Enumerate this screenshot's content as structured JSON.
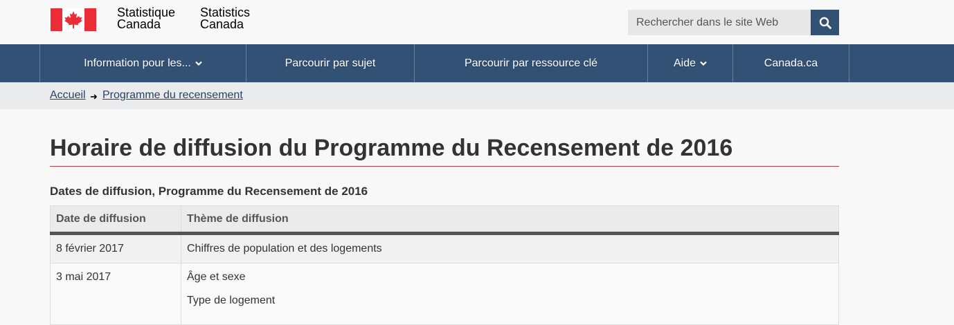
{
  "header": {
    "signature_fr_line1": "Statistique",
    "signature_fr_line2": "Canada",
    "signature_en_line1": "Statistics",
    "signature_en_line2": "Canada",
    "search_placeholder": "Rechercher dans le site Web",
    "search_icon": "search-icon"
  },
  "menu": {
    "items": [
      {
        "label": "Information pour les...",
        "has_dropdown": true
      },
      {
        "label": "Parcourir par sujet",
        "has_dropdown": false
      },
      {
        "label": "Parcourir par ressource clé",
        "has_dropdown": false
      },
      {
        "label": "Aide",
        "has_dropdown": true
      },
      {
        "label": "Canada.ca",
        "has_dropdown": false
      }
    ]
  },
  "breadcrumb": {
    "items": [
      "Accueil",
      "Programme du recensement"
    ]
  },
  "page": {
    "title": "Horaire de diffusion du Programme du Recensement de 2016",
    "table_caption": "Dates de diffusion, Programme du Recensement de 2016"
  },
  "table": {
    "headers": [
      "Date de diffusion",
      "Thème de diffusion"
    ],
    "rows": [
      {
        "date": "8 février 2017",
        "themes": [
          "Chiffres de population et des logements"
        ]
      },
      {
        "date": "3 mai 2017",
        "themes": [
          "Âge et sexe",
          "Type de logement"
        ]
      }
    ]
  },
  "colors": {
    "nav_blue": "#335075",
    "title_rule": "#af3c43",
    "link": "#284162",
    "flag_red": "#eb2d37"
  }
}
